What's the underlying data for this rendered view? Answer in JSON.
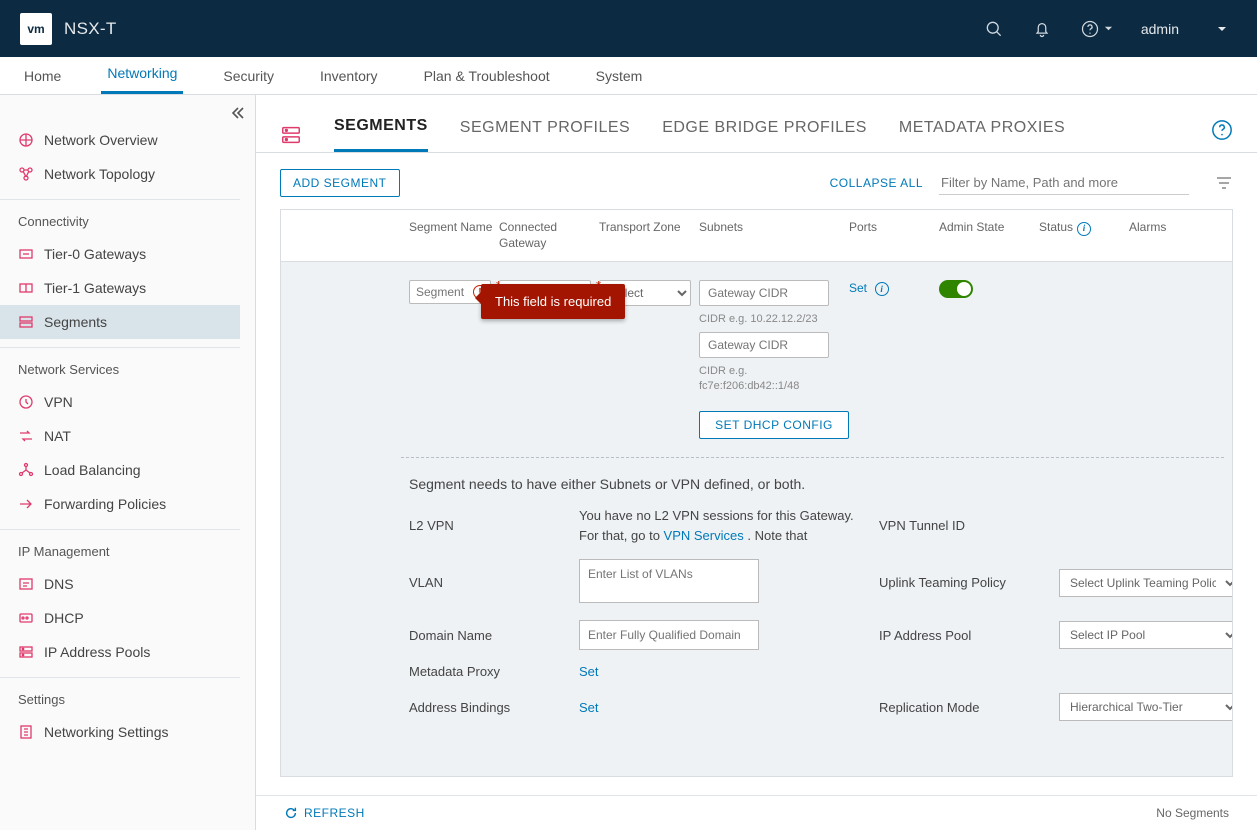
{
  "app": {
    "logo": "vm",
    "title": "NSX-T",
    "user": "admin"
  },
  "globalTabs": [
    "Home",
    "Networking",
    "Security",
    "Inventory",
    "Plan & Troubleshoot",
    "System"
  ],
  "globalActive": 1,
  "sidebar": {
    "top": [
      {
        "label": "Network Overview"
      },
      {
        "label": "Network Topology"
      }
    ],
    "groups": [
      {
        "title": "Connectivity",
        "items": [
          {
            "label": "Tier-0 Gateways"
          },
          {
            "label": "Tier-1 Gateways"
          },
          {
            "label": "Segments",
            "active": true
          }
        ]
      },
      {
        "title": "Network Services",
        "items": [
          {
            "label": "VPN"
          },
          {
            "label": "NAT"
          },
          {
            "label": "Load Balancing"
          },
          {
            "label": "Forwarding Policies"
          }
        ]
      },
      {
        "title": "IP Management",
        "items": [
          {
            "label": "DNS"
          },
          {
            "label": "DHCP"
          },
          {
            "label": "IP Address Pools"
          }
        ]
      },
      {
        "title": "Settings",
        "items": [
          {
            "label": "Networking Settings"
          }
        ]
      }
    ]
  },
  "subtabs": [
    "SEGMENTS",
    "SEGMENT PROFILES",
    "EDGE BRIDGE PROFILES",
    "METADATA PROXIES"
  ],
  "subtabActive": 0,
  "toolbar": {
    "add": "ADD SEGMENT",
    "collapse": "COLLAPSE ALL",
    "filterPlaceholder": "Filter by Name, Path and more"
  },
  "columns": [
    "",
    "Segment Name",
    "Connected Gateway",
    "Transport Zone",
    "Subnets",
    "Ports",
    "Admin State",
    "Status",
    "Alarms"
  ],
  "edit": {
    "segmentNamePlaceholder": "Segment",
    "gatewayPlaceholder": "None",
    "tzPlaceholder": "Select",
    "cidrPlaceholder": "Gateway CIDR",
    "cidrHint1": "CIDR e.g. 10.22.12.2/23",
    "cidrHint2": "CIDR e.g. fc7e:f206:db42::1/48",
    "dhcpBtn": "SET DHCP CONFIG",
    "portsSet": "Set",
    "tooltip": "This field is required"
  },
  "details": {
    "note": "Segment needs to have either Subnets or VPN defined, or both.",
    "l2vpnLabel": "L2 VPN",
    "l2vpnText1": "You have no L2 VPN sessions for this Gateway. For that, go to ",
    "l2vpnLink": "VPN Services",
    "l2vpnText2": " . Note that",
    "vpnTunnelLabel": "VPN Tunnel ID",
    "vlanLabel": "VLAN",
    "vlanPlaceholder": "Enter List of VLANs",
    "uplinkLabel": "Uplink Teaming Policy",
    "uplinkPlaceholder": "Select Uplink Teaming Policy",
    "domainLabel": "Domain Name",
    "domainPlaceholder": "Enter Fully Qualified Domain",
    "ipPoolLabel": "IP Address Pool",
    "ipPoolPlaceholder": "Select IP Pool",
    "metaLabel": "Metadata Proxy",
    "metaSet": "Set",
    "addrLabel": "Address Bindings",
    "addrSet": "Set",
    "replLabel": "Replication Mode",
    "replValue": "Hierarchical Two-Tier"
  },
  "footer": {
    "refresh": "REFRESH",
    "count": "No Segments"
  }
}
